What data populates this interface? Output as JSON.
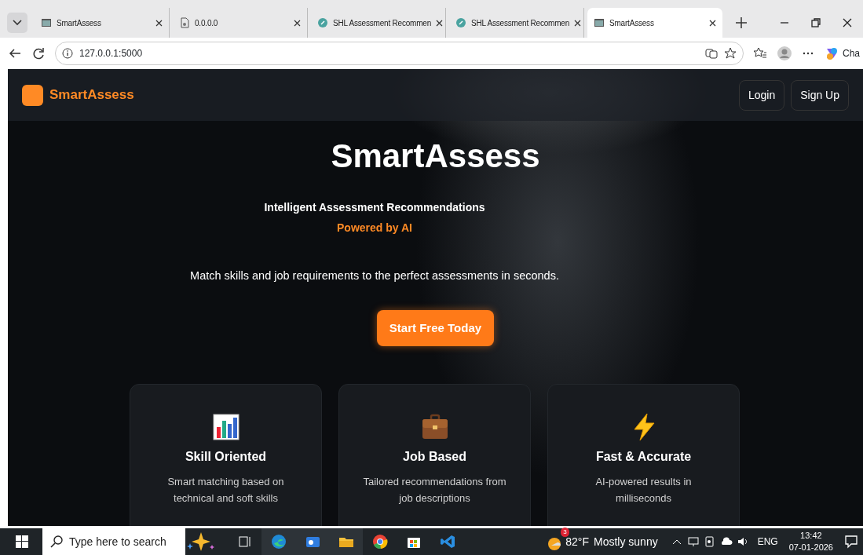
{
  "browser": {
    "tabs": [
      {
        "title": "SmartAssess",
        "kind": "page",
        "selected": false
      },
      {
        "title": "0.0.0.0",
        "kind": "file",
        "selected": false
      },
      {
        "title": "SHL Assessment Recommen",
        "kind": "app",
        "selected": false
      },
      {
        "title": "SHL Assessment Recommen",
        "kind": "app",
        "selected": false
      },
      {
        "title": "SmartAssess",
        "kind": "page",
        "selected": true
      }
    ],
    "address": "127.0.0.1:5000",
    "copilot_label": "Cha"
  },
  "navbar": {
    "brand": "SmartAssess",
    "buttons": [
      "Login",
      "Sign Up"
    ]
  },
  "hero": {
    "title": "SmartAssess",
    "subtitle": "Intelligent Assessment Recommendations",
    "highlight": "Powered by AI",
    "tagline": "Match skills and job requirements to the perfect assessments in seconds.",
    "cta": "Start Free Today"
  },
  "features": [
    {
      "kind": "chart",
      "title": "Skill Oriented",
      "description": "Smart matching based on technical and soft skills"
    },
    {
      "kind": "briefcase",
      "title": "Job Based",
      "description": "Tailored recommendations from job descriptions"
    },
    {
      "kind": "bolt",
      "title": "Fast & Accurate",
      "description": "AI-powered results in milliseconds"
    }
  ],
  "taskbar": {
    "search_placeholder": "Type here to search",
    "weather_badge": "3",
    "temperature": "82°F",
    "condition": "Mostly sunny",
    "language": "ENG",
    "time": "13:42",
    "date": "07-01-2026"
  }
}
